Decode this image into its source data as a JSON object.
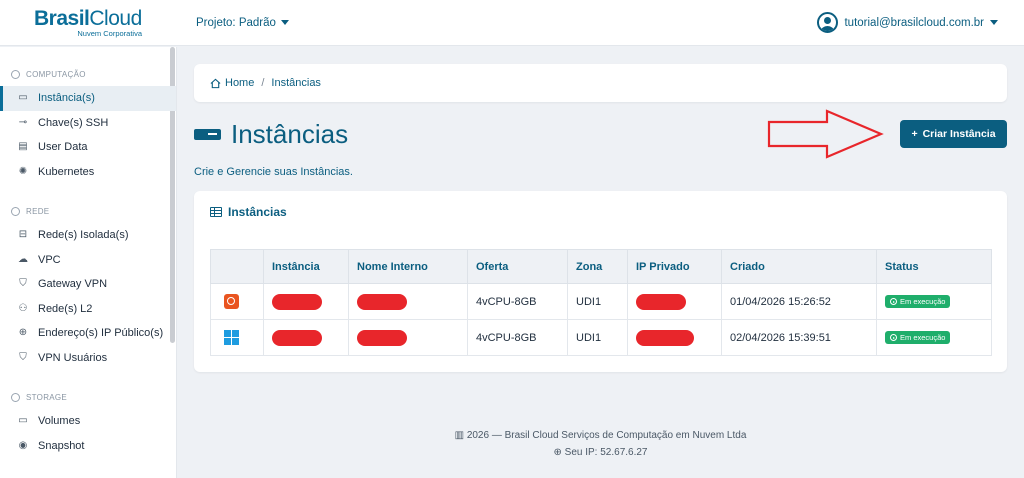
{
  "logo": {
    "brand_a": "Brasil",
    "brand_b": "Cloud",
    "tagline": "Nuvem Corporativa"
  },
  "header": {
    "project_label": "Projeto: Padrão",
    "user_email": "tutorial@brasilcloud.com.br"
  },
  "sidebar": {
    "sections": [
      {
        "title": "COMPUTAÇÃO",
        "items": [
          "Instância(s)",
          "Chave(s) SSH",
          "User Data",
          "Kubernetes"
        ]
      },
      {
        "title": "REDE",
        "items": [
          "Rede(s) Isolada(s)",
          "VPC",
          "Gateway VPN",
          "Rede(s) L2",
          "Endereço(s) IP Público(s)",
          "VPN Usuários"
        ]
      },
      {
        "title": "STORAGE",
        "items": [
          "Volumes",
          "Snapshot"
        ]
      }
    ]
  },
  "breadcrumb": {
    "home": "Home",
    "separator": "/",
    "current": "Instâncias"
  },
  "page": {
    "title": "Instâncias",
    "subtitle": "Crie e Gerencie suas Instâncias.",
    "create_button": "Criar Instância"
  },
  "table": {
    "title": "Instâncias",
    "columns": [
      "",
      "Instância",
      "Nome Interno",
      "Oferta",
      "Zona",
      "IP Privado",
      "Criado",
      "Status"
    ],
    "rows": [
      {
        "os": "ubuntu",
        "oferta": "4vCPU-8GB",
        "zona": "UDI1",
        "criado": "01/04/2026 15:26:52",
        "status": "Em execução"
      },
      {
        "os": "windows",
        "oferta": "4vCPU-8GB",
        "zona": "UDI1",
        "criado": "02/04/2026 15:39:51",
        "status": "Em execução"
      }
    ]
  },
  "footer": {
    "copyright": "2026 — Brasil Cloud Serviços de Computação em Nuvem Ltda",
    "ip": "Seu IP: 52.67.6.27"
  },
  "colors": {
    "primary": "#0b5e80",
    "accent_red": "#e8262b",
    "status_green": "#1fae6b"
  }
}
